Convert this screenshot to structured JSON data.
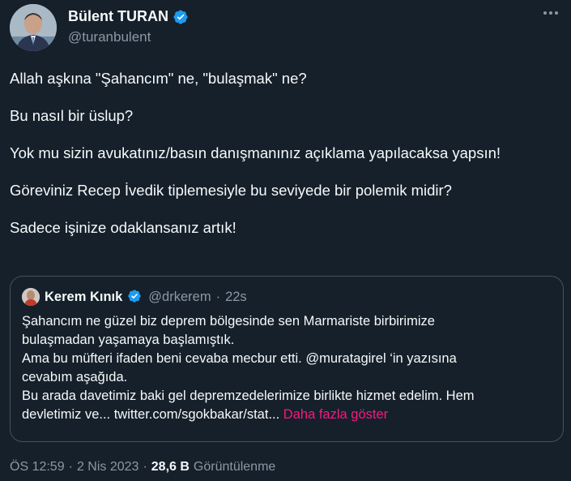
{
  "author": {
    "name": "Bülent TURAN",
    "handle": "@turanbulent"
  },
  "tweet": {
    "paragraphs": [
      "Allah aşkına \"Şahancım\" ne, \"bulaşmak\" ne?",
      "Bu nasıl bir üslup?",
      "Yok mu sizin avukatınız/basın danışmanınız açıklama yapılacaksa yapsın!",
      "Göreviniz Recep İvedik tiplemesiyle bu seviyede bir polemik midir?",
      "Sadece işinize odaklansanız artık!"
    ]
  },
  "quote": {
    "name": "Kerem Kınık",
    "handle": "@drkerem",
    "separator": "·",
    "time": "22s",
    "lines": [
      "Şahancım ne güzel biz deprem bölgesinde sen Marmariste birbirimize",
      "bulaşmadan yaşamaya başlamıştık.",
      "Ama bu müfteri ifaden beni cevaba mecbur etti. @muratagirel ‘in yazısına",
      "cevabım aşağıda.",
      "Bu arada davetimiz baki gel depremzedelerimize birlikte hizmet edelim. Hem"
    ],
    "last_line": "devletimiz ve... twitter.com/sgokbakar/stat...",
    "show_more": "Daha fazla göster"
  },
  "meta": {
    "time": "ÖS 12:59",
    "dot": "·",
    "date": "2 Nis 2023",
    "dot2": "·",
    "views": "28,6 B",
    "views_label": "Görüntülenme"
  },
  "colors": {
    "background": "#15202b",
    "verified": "#1d9bf0",
    "link": "#f91880",
    "muted": "#8b98a5"
  },
  "icons": [
    "verified-badge-icon",
    "more-options-icon"
  ]
}
